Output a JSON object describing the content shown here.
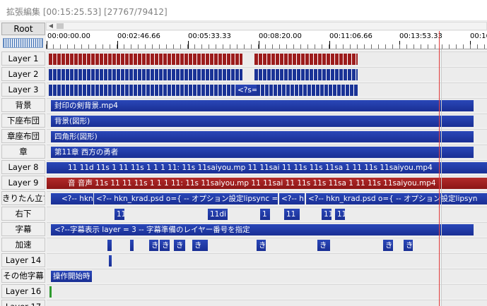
{
  "window": {
    "title": "拡張編集 [00:15:25.53] [27767/79412]"
  },
  "root_label": "Root",
  "ruler": {
    "labels": [
      "00:00:00.00",
      "00:02:46.66",
      "00:05:33.33",
      "00:08:20.00",
      "00:11:06.66",
      "00:13:53.33",
      "00:16"
    ]
  },
  "layers": [
    {
      "name": "Layer 1"
    },
    {
      "name": "Layer 2"
    },
    {
      "name": "Layer 3"
    },
    {
      "name": "背景"
    },
    {
      "name": "下座布団"
    },
    {
      "name": "章座布団"
    },
    {
      "name": "章"
    },
    {
      "name": "Layer 8"
    },
    {
      "name": "Layer 9"
    },
    {
      "name": "きりたん立ち"
    },
    {
      "name": "右下"
    },
    {
      "name": "字幕"
    },
    {
      "name": "加速"
    },
    {
      "name": "Layer 14"
    },
    {
      "name": "その他字幕"
    },
    {
      "name": "Layer 16"
    },
    {
      "name": "Layer 17"
    }
  ],
  "clips": {
    "layer3_text": "<?s=",
    "bg_video": "封印の剣背景.mp4",
    "lower_cushion": "背景(図形)",
    "chapter_cushion": "四角形(図形)",
    "chapter_title": "第11章 西方の勇者",
    "layer8_a": "11 11d 11s 1 11 11s 1 1 1 11: 11s 11saiyou.mp 11 11sai 11 11s 11s 11sa 1 11 11s 11saiyou.mp4",
    "layer9_a": "音 音声 11s 11 11 11s 1 1 1 11: 11s 11saiyou.mp 11 11sai 11 11s 11s 11sa 1 11 11s 11saiyou.mp4",
    "kiritan_a": "<?-- hkn",
    "kiritan_b": "<?-- hkn_krad.psd o={ -- オプション設定lipsync = ",
    "kiritan_c": "<?-- hkn",
    "kiritan_d": "<?-- hkn_krad.psd o={ -- オプション設定lipsyn",
    "lower_right_a": "11",
    "lower_right_b": "11di",
    "lower_right_c": "1",
    "lower_right_d": "11",
    "lower_right_e": "11",
    "lower_right_f": "11",
    "subtitle": "<?--字幕表示    layer = 3    -- 字幕準備のレイヤー番号を指定",
    "accel_a": "き",
    "accel_b": "き",
    "accel_c": "き",
    "accel_d": "き",
    "accel_e": "き",
    "accel_f": "き",
    "accel_g": "き",
    "accel_h": "き",
    "other_subtitle": "操作開始時"
  }
}
